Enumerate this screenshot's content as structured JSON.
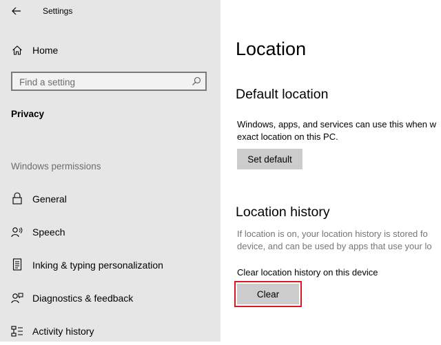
{
  "header": {
    "title": "Settings"
  },
  "sidebar": {
    "home_label": "Home",
    "search_placeholder": "Find a setting",
    "section_title": "Privacy",
    "group_label": "Windows permissions",
    "items": [
      {
        "label": "General",
        "icon": "lock-icon"
      },
      {
        "label": "Speech",
        "icon": "speech-icon"
      },
      {
        "label": "Inking & typing personalization",
        "icon": "inking-icon"
      },
      {
        "label": "Diagnostics & feedback",
        "icon": "diagnostics-icon"
      },
      {
        "label": "Activity history",
        "icon": "activity-history-icon"
      }
    ]
  },
  "main": {
    "title": "Location",
    "default_location": {
      "heading": "Default location",
      "description": "Windows, apps, and services can use this when w exact location on this PC.",
      "description_line1": "Windows, apps, and services can use this when w",
      "description_line2": "exact location on this PC.",
      "button_label": "Set default"
    },
    "location_history": {
      "heading": "Location history",
      "description_line1": "If location is on, your location history is stored fo",
      "description_line2": "device, and can be used by apps that use your lo",
      "clear_label": "Clear location history on this device",
      "button_label": "Clear"
    }
  },
  "colors": {
    "sidebar_bg": "#e6e6e6",
    "button_bg": "#cccccc",
    "highlight_border": "#d9191f",
    "secondary_text": "#767676"
  }
}
